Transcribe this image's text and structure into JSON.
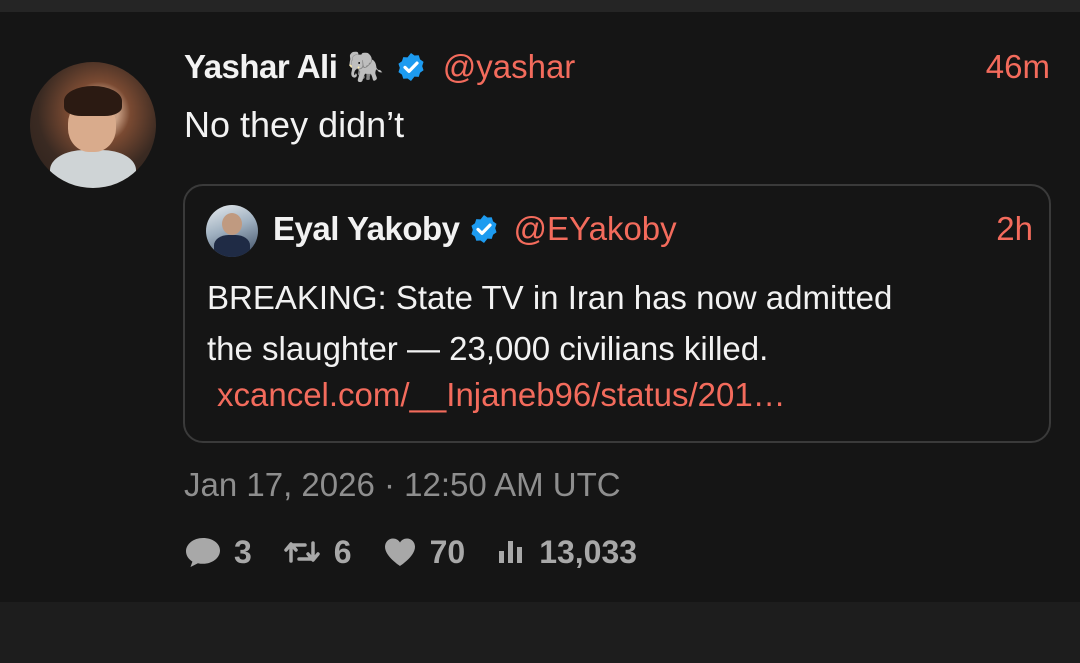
{
  "tweet": {
    "author_name": "Yashar Ali",
    "author_emoji": "🐘",
    "handle": "@yashar",
    "time": "46m",
    "text": "No they didn’t",
    "date": "Jan 17, 2026 · 12:50 AM UTC",
    "stats": {
      "replies": "3",
      "retweets": "6",
      "likes": "70",
      "views": "13,033"
    }
  },
  "quote": {
    "author_name": "Eyal Yakoby",
    "handle": "@EYakoby",
    "time": "2h",
    "text_lines": [
      "BREAKING: State TV in Iran has now admitted",
      "the slaughter — 23,000 civilians killed."
    ],
    "link": "xcancel.com/__Injaneb96/status/201…"
  },
  "colors": {
    "accent": "#f36b5c",
    "verified": "#1d9bf0",
    "background": "#151515",
    "text": "#f2f2f2",
    "muted": "#8e8e8e"
  },
  "icons": {
    "verified": "verified-badge-icon",
    "reply": "comment-bubble-icon",
    "retweet": "retweet-icon",
    "like": "heart-icon",
    "views": "bar-chart-icon"
  }
}
